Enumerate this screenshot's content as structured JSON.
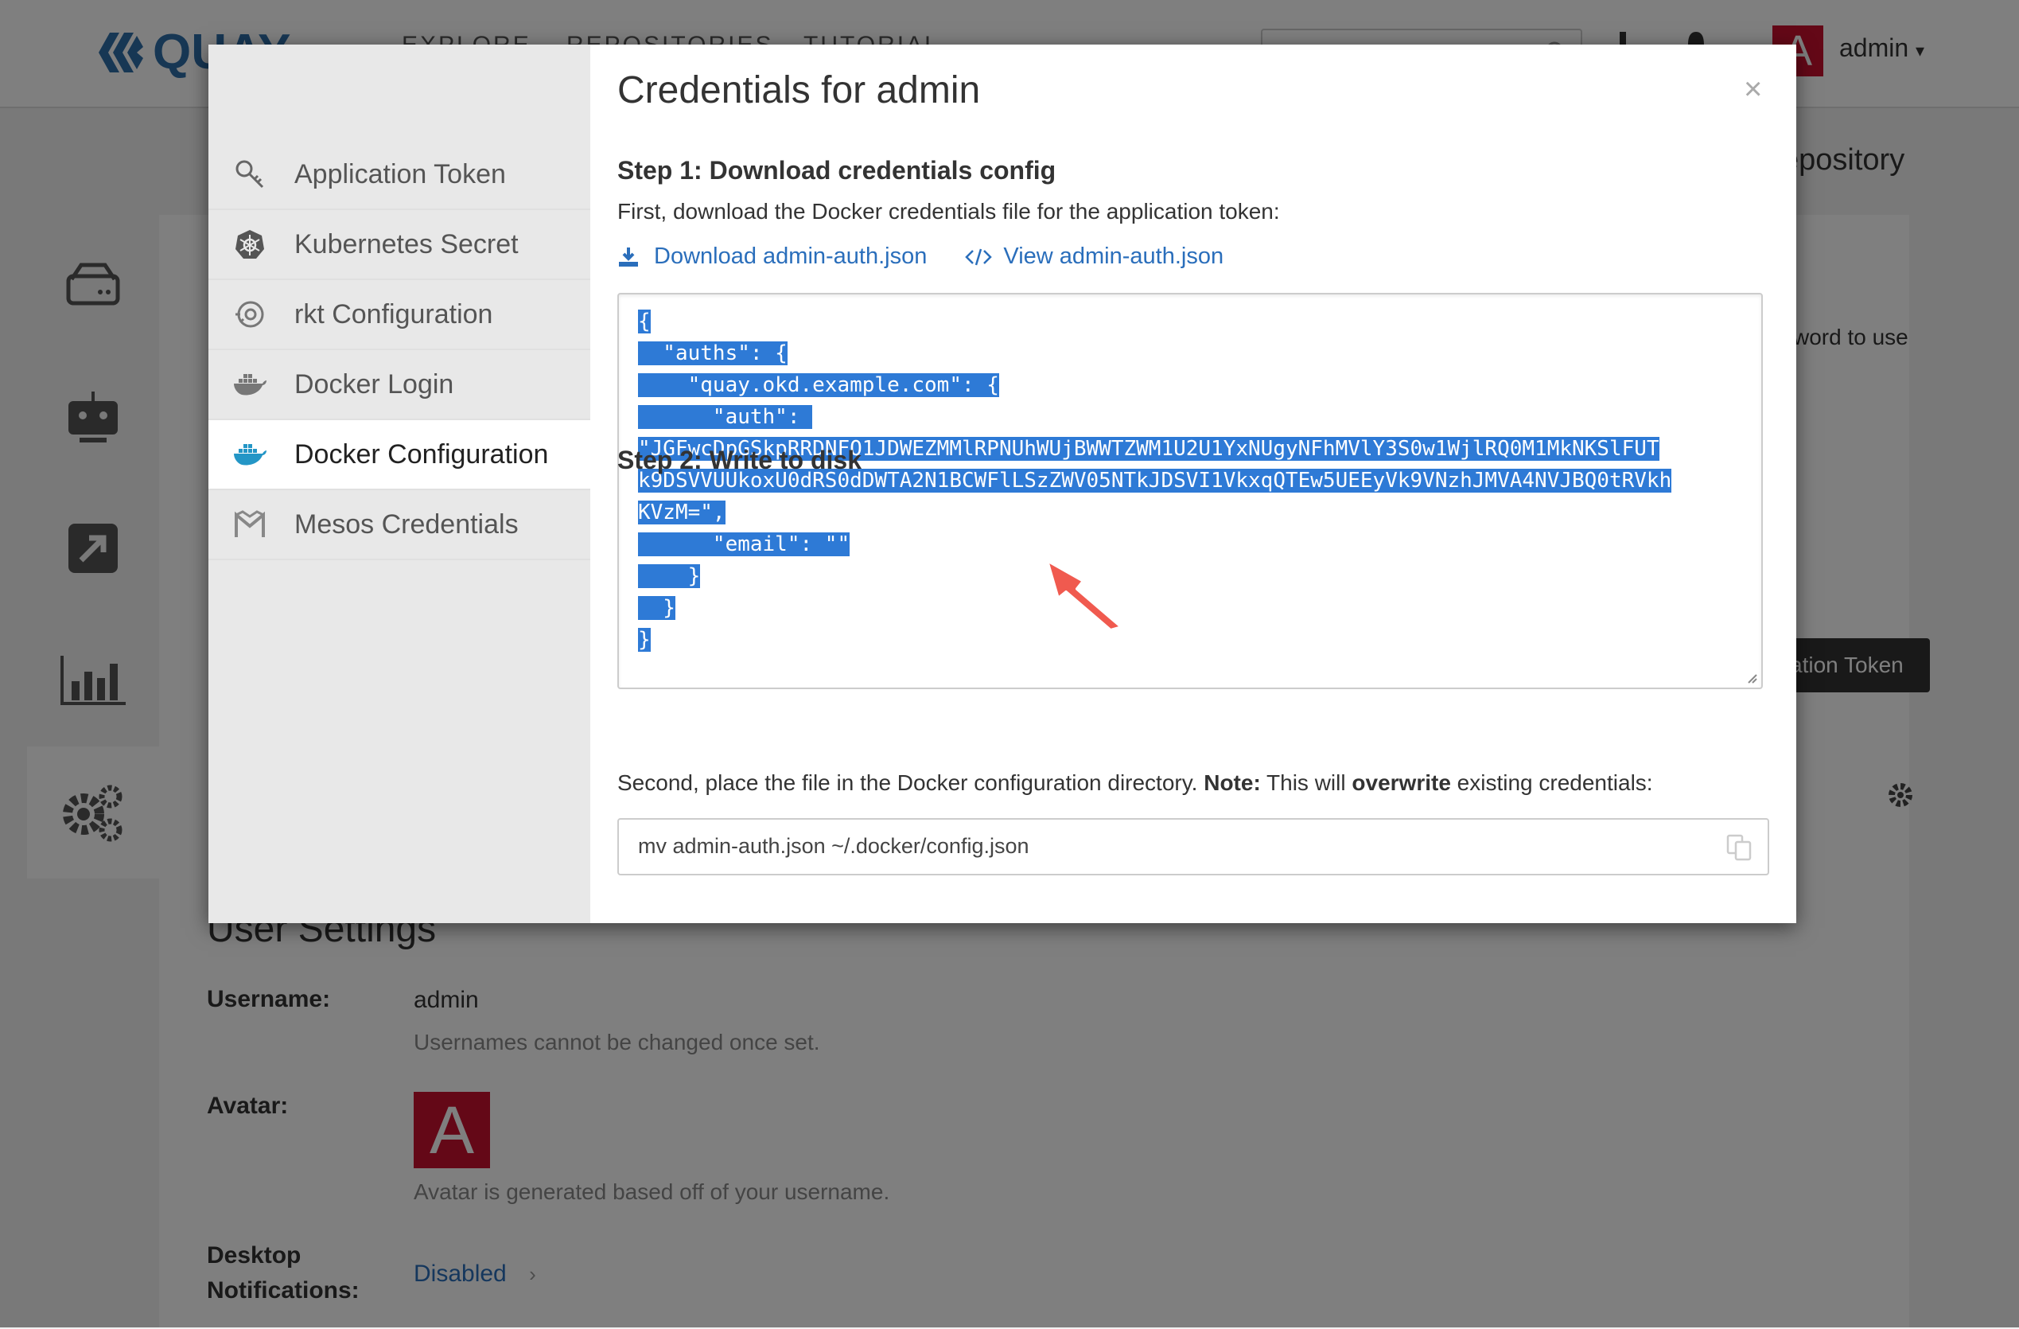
{
  "header": {
    "logo_text": "QUAY",
    "nav": [
      "EXPLORE",
      "REPOSITORIES",
      "TUTORIAL"
    ],
    "avatar_letter": "A",
    "username": "admin",
    "brand_color": "#2f6ea8"
  },
  "background": {
    "fragment_repository": "epository",
    "fragment_password": "sword to use",
    "fragment_token_button": "ation Token",
    "user_settings_title": "User Settings",
    "username_label": "Username:",
    "username_value": "admin",
    "username_help": "Usernames cannot be changed once set.",
    "avatar_label": "Avatar:",
    "avatar_letter": "A",
    "avatar_help": "Avatar is generated based off of your username.",
    "notifications_label_1": "Desktop",
    "notifications_label_2": "Notifications:",
    "notifications_value": "Disabled",
    "avatar_color": "#c8102e"
  },
  "modal": {
    "title": "Credentials for admin",
    "close": "×",
    "sidebar": [
      {
        "label": "Application Token",
        "icon": "key-icon"
      },
      {
        "label": "Kubernetes Secret",
        "icon": "kubernetes-icon"
      },
      {
        "label": "rkt Configuration",
        "icon": "rkt-icon"
      },
      {
        "label": "Docker Login",
        "icon": "docker-icon"
      },
      {
        "label": "Docker Configuration",
        "icon": "docker-icon"
      },
      {
        "label": "Mesos Credentials",
        "icon": "mesos-icon"
      }
    ],
    "active_index": 4,
    "step1": {
      "title": "Step 1: Download credentials config",
      "desc": "First, download the Docker credentials file for the application token:",
      "download_label": "Download admin-auth.json",
      "view_label": "View admin-auth.json"
    },
    "code_lines": [
      "{",
      "  \"auths\": {",
      "    \"quay.okd.example.com\": {",
      "      \"auth\": ",
      "\"JGFwcDpGSkpRRDNFQ1JDWEZMMlRPNUhWUjBWWTZWM1U2U1YxNUgyNFhMVlY3S0w1WjlRQ0M1MkNKSlFUT",
      "k9DSVVUUkoxU0dRS0dDWTA2N1BCWFlLSzZWV05NTkJDSVI1VkxqQTEw5UEEyVk9VNzhJMVA4NVJBQ0tRVkh",
      "KVzM=\",",
      "      \"email\": \"\"",
      "    }",
      "  }",
      "}"
    ],
    "step2": {
      "title": "Step 2: Write to disk",
      "desc_prefix": "Second, place the file in the Docker configuration directory. ",
      "note_label": "Note:",
      "desc_mid": " This will ",
      "overwrite_label": "overwrite",
      "desc_suffix": " existing credentials:",
      "command": "mv admin-auth.json ~/.docker/config.json"
    },
    "selection_color": "#2e7ad6",
    "link_color": "#2a6ebb"
  }
}
